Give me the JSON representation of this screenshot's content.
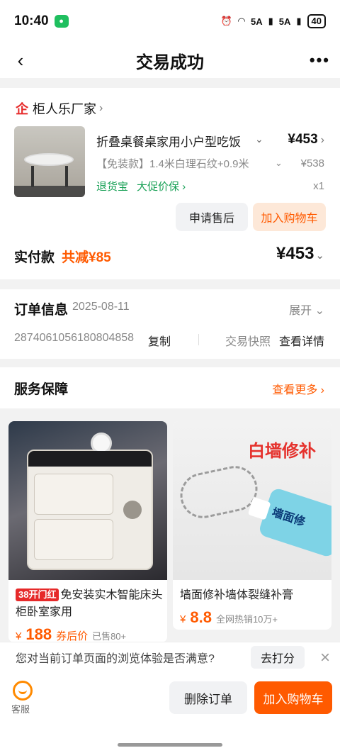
{
  "status_bar": {
    "time": "10:40",
    "network_1": "5A",
    "network_2": "5A",
    "battery": "40"
  },
  "navbar": {
    "title": "交易成功",
    "back_icon": "‹",
    "more_icon": "•••"
  },
  "shop": {
    "name": "柜人乐厂家",
    "logo_glyph": "企"
  },
  "product": {
    "title": "折叠桌餐桌家用小户型吃饭",
    "price": "¥453",
    "sku": "【免装款】1.4米白理石纹+0.9米",
    "original_price": "¥538",
    "tags": [
      "退货宝",
      "大促价保 ›"
    ],
    "quantity": "x1"
  },
  "actions": {
    "after_sale": "申请售后",
    "add_cart": "加入购物车"
  },
  "payment": {
    "label": "实付款",
    "discount": "共减¥85",
    "total": "¥453"
  },
  "order_info": {
    "title": "订单信息",
    "date": "2025-08-11",
    "expand": "展开",
    "order_no": "2874061056180804858",
    "copy": "复制",
    "snapshot": "交易快照",
    "detail": "查看详情"
  },
  "service": {
    "title": "服务保障",
    "more": "查看更多"
  },
  "recommendations": [
    {
      "badge": "38开门红",
      "name": "免安装实木智能床头柜卧室家用",
      "price_symbol": "¥",
      "price": "188",
      "price_note": "券后价",
      "sales": "已售80+"
    },
    {
      "image_text": "白墙修补",
      "tube_label": "墙面修",
      "name": "墙面修补墙体裂缝补膏",
      "price_symbol": "¥",
      "price": "8.8",
      "sales": "全网热销10万+"
    }
  ],
  "survey": {
    "text": "您对当前订单页面的浏览体验是否满意?",
    "button": "去打分"
  },
  "bottom_bar": {
    "service_label": "客服",
    "delete_order": "删除订单",
    "add_cart": "加入购物车"
  },
  "colors": {
    "accent": "#ff5a00",
    "green": "#17a055",
    "brand_red": "#e62a2a"
  }
}
